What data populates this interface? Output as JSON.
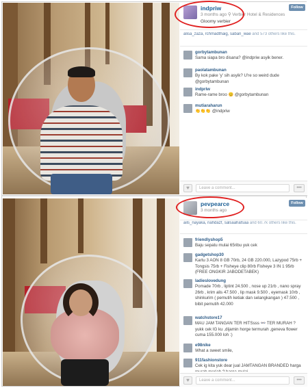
{
  "posts": [
    {
      "username": "indpriw",
      "time": "3 months ago",
      "location": "Verbier Hotel & Residences",
      "caption": "Gloomy verbier",
      "follow_label": "Follow",
      "likes": {
        "names": "alisa_zaza, rchmadthaig, saban_wae",
        "rest": "and 573 others like this."
      },
      "comments": [
        {
          "user": "gorbytambunan",
          "text": "Sama siapa bro disana? @indpriw asyik bener."
        },
        {
          "user": "paolatambunan",
          "text": "By kok pake 'y' sih asyik? U're so weird dude @gorbytambunan"
        },
        {
          "user": "indpriw",
          "text": "Rame-rame broo 😊 @gorbytambunan"
        },
        {
          "user": "mutiaraharun",
          "text": "👏👏👏 @indpriw"
        }
      ],
      "comment_placeholder": "Leave a comment..."
    },
    {
      "username": "pevpearce",
      "time": "3 months ago",
      "follow_label": "Follow",
      "likes": {
        "names": "ails_nayaka, nahdazf, salsaahafsaa",
        "rest": "and 60.7k others like this."
      },
      "comments": [
        {
          "user": "friendlyshop5",
          "text": "Baju sepatu mulai 65ribu yuk cek"
        },
        {
          "user": "gadgetshop30",
          "text": "Kartu 3 AON 8 GB 70rb, 24 GB 220.000, Lazypod 75rb + Tongsis 75rb + Fisheye clip 80rb Fisheye 3 IN 1 95rb (FREE ONGKIR JABODETABEK)"
        },
        {
          "user": "ladieslovedung",
          "text": "Pomade 70rb , liptint 24.500 , nose up 21rb , nano spray 26rb , krim alis 47.500 , lip mask 9.500 , eyemask 10rb , shinkurim ( pemutih ketiak dan selangkangan ) 47.500 , bibit pemutih 42.000"
        },
        {
          "user": "watchstore17",
          "text": "MAU JAM TANGAN TER HITSsss 👓 TER MURAH ? yukk cek IG ku ,dijamin horge termurah ,geneva flower cuma 155.000 loh :)"
        },
        {
          "user": "e98nike",
          "text": "What a sweet smile,"
        },
        {
          "user": "911fashionstore",
          "text": "Cek ig kita yuk dear jual JAMTANGAN BRANDED harga murah meriah ? harga mulai..."
        }
      ],
      "comment_placeholder": "Leave a comment..."
    }
  ],
  "icons": {
    "heart": "heart-icon",
    "more": "more-icon",
    "location": "location-icon"
  },
  "colors": {
    "username": "#1c5f95",
    "follow": "#6d8fb0",
    "highlight": "#e02020"
  }
}
